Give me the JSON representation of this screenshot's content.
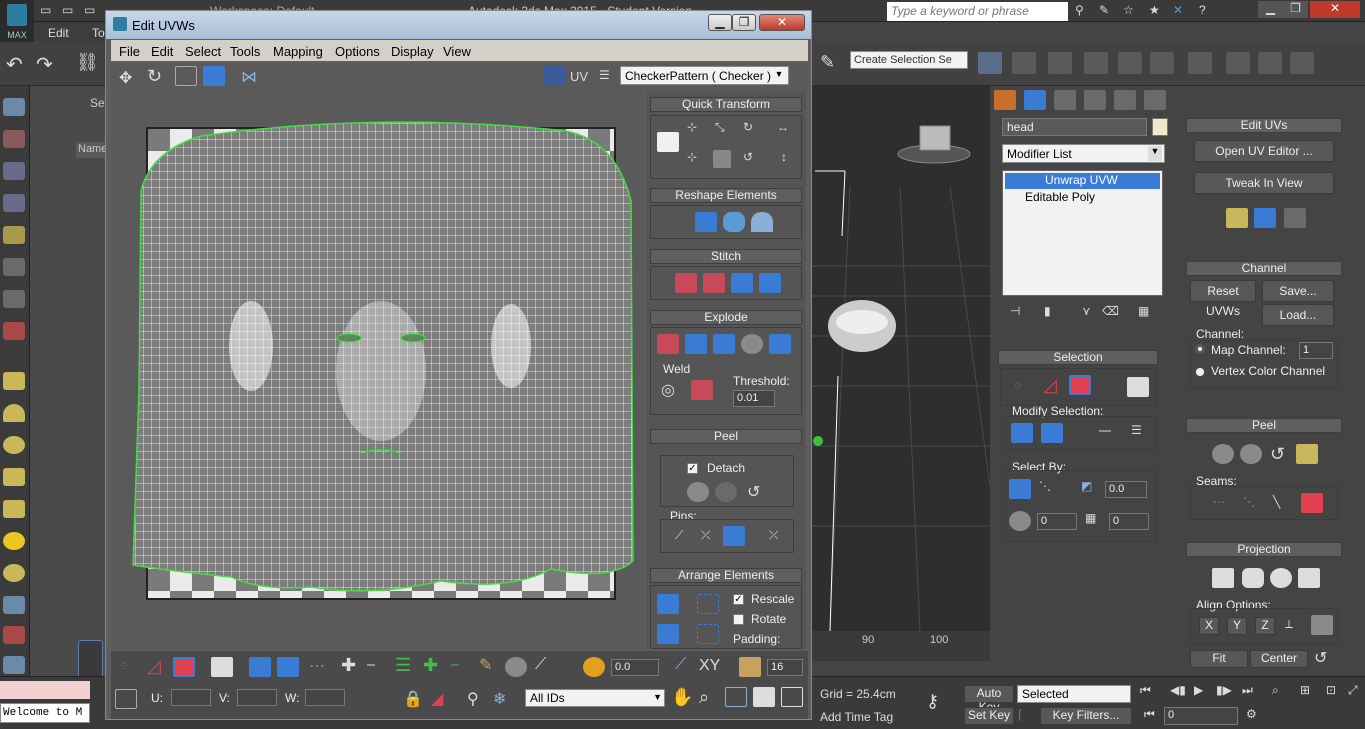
{
  "app": {
    "logo_label": "MAX",
    "main_menu": [
      "Edit",
      "To"
    ],
    "search_placeholder": "Type a keyword or phrase",
    "title_partial": "Autodesk 3ds Max 2015 - Student Version",
    "workspace_partial": "Workspace: Default"
  },
  "uvw_window": {
    "title": "Edit UVWs",
    "menu": [
      "File",
      "Edit",
      "Select",
      "Tools",
      "Mapping",
      "Options",
      "Display",
      "View"
    ],
    "uv_label": "UV",
    "texture_dropdown": "CheckerPattern ( Checker )",
    "rollouts": {
      "quick_transform": "Quick Transform",
      "reshape_elements": "Reshape Elements",
      "stitch": "Stitch",
      "explode": "Explode",
      "weld_label": "Weld",
      "threshold_label": "Threshold:",
      "threshold_value": "0.01",
      "peel": "Peel",
      "detach_label": "Detach",
      "pins_label": "Pins:",
      "arrange_elements": "Arrange Elements",
      "rescale_label": "Rescale",
      "rotate_label": "Rotate",
      "padding_label": "Padding:"
    },
    "bottom": {
      "value_field": "0.0",
      "xy_label": "XY",
      "grid_value": "16",
      "u_label": "U:",
      "v_label": "V:",
      "w_label": "W:",
      "ids_dropdown": "All IDs"
    }
  },
  "command_panel": {
    "object_name": "head",
    "modifier_list": "Modifier List",
    "stack": [
      "Unwrap UVW",
      "Editable Poly"
    ],
    "selection_title": "Selection",
    "modify_selection_label": "Modify Selection:",
    "select_by_label": "Select By:",
    "select_by_value": "0.0",
    "spinner1": "0",
    "spinner2": "0",
    "edit_uvs_title": "Edit UVs",
    "open_uv_editor": "Open UV Editor ...",
    "tweak_in_view": "Tweak In View",
    "channel_title": "Channel",
    "reset_uvws": "Reset UVWs",
    "save": "Save...",
    "load": "Load...",
    "channel_label": "Channel:",
    "map_channel": "Map Channel:",
    "map_channel_value": "1",
    "vertex_color_channel": "Vertex Color Channel",
    "peel_title": "Peel",
    "seams_label": "Seams:",
    "projection_title": "Projection",
    "align_options_label": "Align Options:",
    "fit": "Fit",
    "center": "Center"
  },
  "main_toolbar": {
    "selection_set": "Create Selection Se"
  },
  "status": {
    "welcome": "Welcome to M",
    "grid": "Grid = 25.4cm",
    "add_time_tag": "Add Time Tag",
    "auto_key": "Auto Key",
    "selected": "Selected",
    "set_key": "Set Key",
    "key_filters": "Key Filters...",
    "frame": "0",
    "ruler_90": "90",
    "ruler_100": "100"
  },
  "scene_panel": {
    "header": "Name",
    "tab": "Se"
  },
  "colors": {
    "accent_blue": "#3a7bd5",
    "selection_red": "#e04050",
    "uv_border_green": "#40e040"
  }
}
